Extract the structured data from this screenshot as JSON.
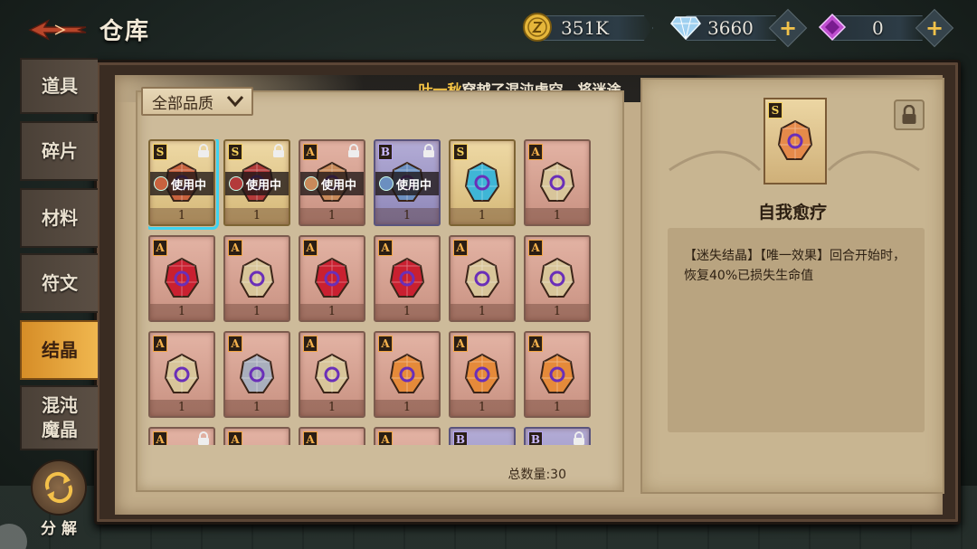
{
  "header": {
    "title": "仓库",
    "currencies": [
      {
        "icon": "gold-coin-icon",
        "value": "351K",
        "has_plus": false
      },
      {
        "icon": "diamond-icon",
        "value": "3660",
        "has_plus": true
      },
      {
        "icon": "purple-crystal-icon",
        "value": "0",
        "has_plus": true
      }
    ]
  },
  "ticker": {
    "name": "叶一秋",
    "message": "穿越了混沌虚空，将迷途"
  },
  "tabs": [
    {
      "label": "道具",
      "active": false
    },
    {
      "label": "碎片",
      "active": false
    },
    {
      "label": "材料",
      "active": false
    },
    {
      "label": "符文",
      "active": false
    },
    {
      "label": "结晶",
      "active": true
    },
    {
      "label": "混沌\n魔晶",
      "active": false
    }
  ],
  "decompose": {
    "label": "分解"
  },
  "filter": {
    "label": "全部品质"
  },
  "items": [
    {
      "rank": "S",
      "color": "#c8623e",
      "qty": "1",
      "locked": true,
      "in_use": "使用中",
      "selected": true
    },
    {
      "rank": "S",
      "color": "#b33a3a",
      "qty": "1",
      "locked": true,
      "in_use": "使用中"
    },
    {
      "rank": "A",
      "color": "#c88a5a",
      "qty": "1",
      "locked": true,
      "in_use": "使用中"
    },
    {
      "rank": "B",
      "color": "#6b8fc0",
      "qty": "1",
      "locked": true,
      "in_use": "使用中"
    },
    {
      "rank": "S",
      "color": "#3fb6d6",
      "qty": "1",
      "locked": false
    },
    {
      "rank": "A",
      "color": "#d8c59a",
      "qty": "1",
      "locked": false
    },
    {
      "rank": "A",
      "color": "#c92030",
      "qty": "1",
      "locked": false
    },
    {
      "rank": "A",
      "color": "#d8c59a",
      "qty": "1",
      "locked": false
    },
    {
      "rank": "A",
      "color": "#c92030",
      "qty": "1",
      "locked": false
    },
    {
      "rank": "A",
      "color": "#c92030",
      "qty": "1",
      "locked": false
    },
    {
      "rank": "A",
      "color": "#d8c59a",
      "qty": "1",
      "locked": false
    },
    {
      "rank": "A",
      "color": "#d8c59a",
      "qty": "1",
      "locked": false
    },
    {
      "rank": "A",
      "color": "#d8c59a",
      "qty": "1",
      "locked": false
    },
    {
      "rank": "A",
      "color": "#a9afbd",
      "qty": "1",
      "locked": false
    },
    {
      "rank": "A",
      "color": "#d8c59a",
      "qty": "1",
      "locked": false
    },
    {
      "rank": "A",
      "color": "#e58a3a",
      "qty": "1",
      "locked": false
    },
    {
      "rank": "A",
      "color": "#e58a3a",
      "qty": "1",
      "locked": false
    },
    {
      "rank": "A",
      "color": "#e58a3a",
      "qty": "1",
      "locked": false
    },
    {
      "rank": "A",
      "color": "#2aa34a",
      "qty": "",
      "locked": true
    },
    {
      "rank": "A",
      "color": "#c92030",
      "qty": "",
      "locked": false
    },
    {
      "rank": "A",
      "color": "#e0e0e0",
      "qty": "",
      "locked": false
    },
    {
      "rank": "A",
      "color": "#e58a3a",
      "qty": "",
      "locked": false
    },
    {
      "rank": "B",
      "color": "#d8c59a",
      "qty": "",
      "locked": false
    },
    {
      "rank": "B",
      "color": "#d8c59a",
      "qty": "",
      "locked": true
    }
  ],
  "total": "总数量:30",
  "detail": {
    "rank": "S",
    "color": "#e58a4a",
    "name": "自我愈疗",
    "description": "【迷失结晶】【唯一效果】回合开始时，恢复40%已损失生命值"
  }
}
